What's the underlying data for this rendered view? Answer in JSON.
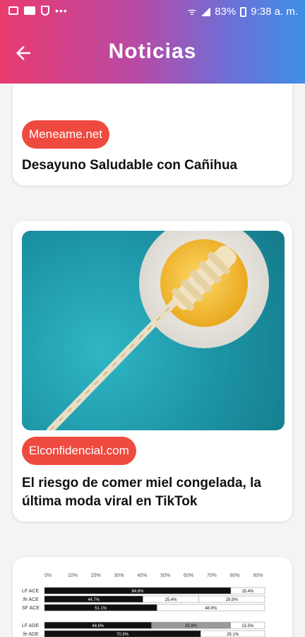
{
  "status_bar": {
    "battery": "83%",
    "time": "9:38 a. m."
  },
  "app_bar": {
    "title": "Noticias"
  },
  "articles": [
    {
      "source": "Meneame.net",
      "title": "Desayuno Saludable con Cañihua"
    },
    {
      "source": "Elconfidencial.com",
      "title_line1": "El riesgo de comer miel congelada, la",
      "title_line2": "última moda viral en TikTok"
    }
  ],
  "preview_chart": {
    "ticks": [
      "0%",
      "10%",
      "20%",
      "30%",
      "40%",
      "50%",
      "60%",
      "70%",
      "80%",
      "90%"
    ],
    "rows": [
      {
        "label": "LF ACE",
        "segments": [
          "84.6%",
          "15.4%"
        ]
      },
      {
        "label": ".fe ACE",
        "segments": [
          "44.7%",
          "25.4%",
          "29.9%"
        ]
      },
      {
        "label": "SF ACE",
        "segments": [
          "51.1%",
          "48.9%"
        ]
      },
      {
        "label": "LF ADE",
        "segments": [
          "48.6%",
          "35.9%",
          "15.5%"
        ]
      },
      {
        "label": ".fe ADE",
        "segments": [
          "70.9%",
          "29.1%"
        ]
      }
    ]
  }
}
